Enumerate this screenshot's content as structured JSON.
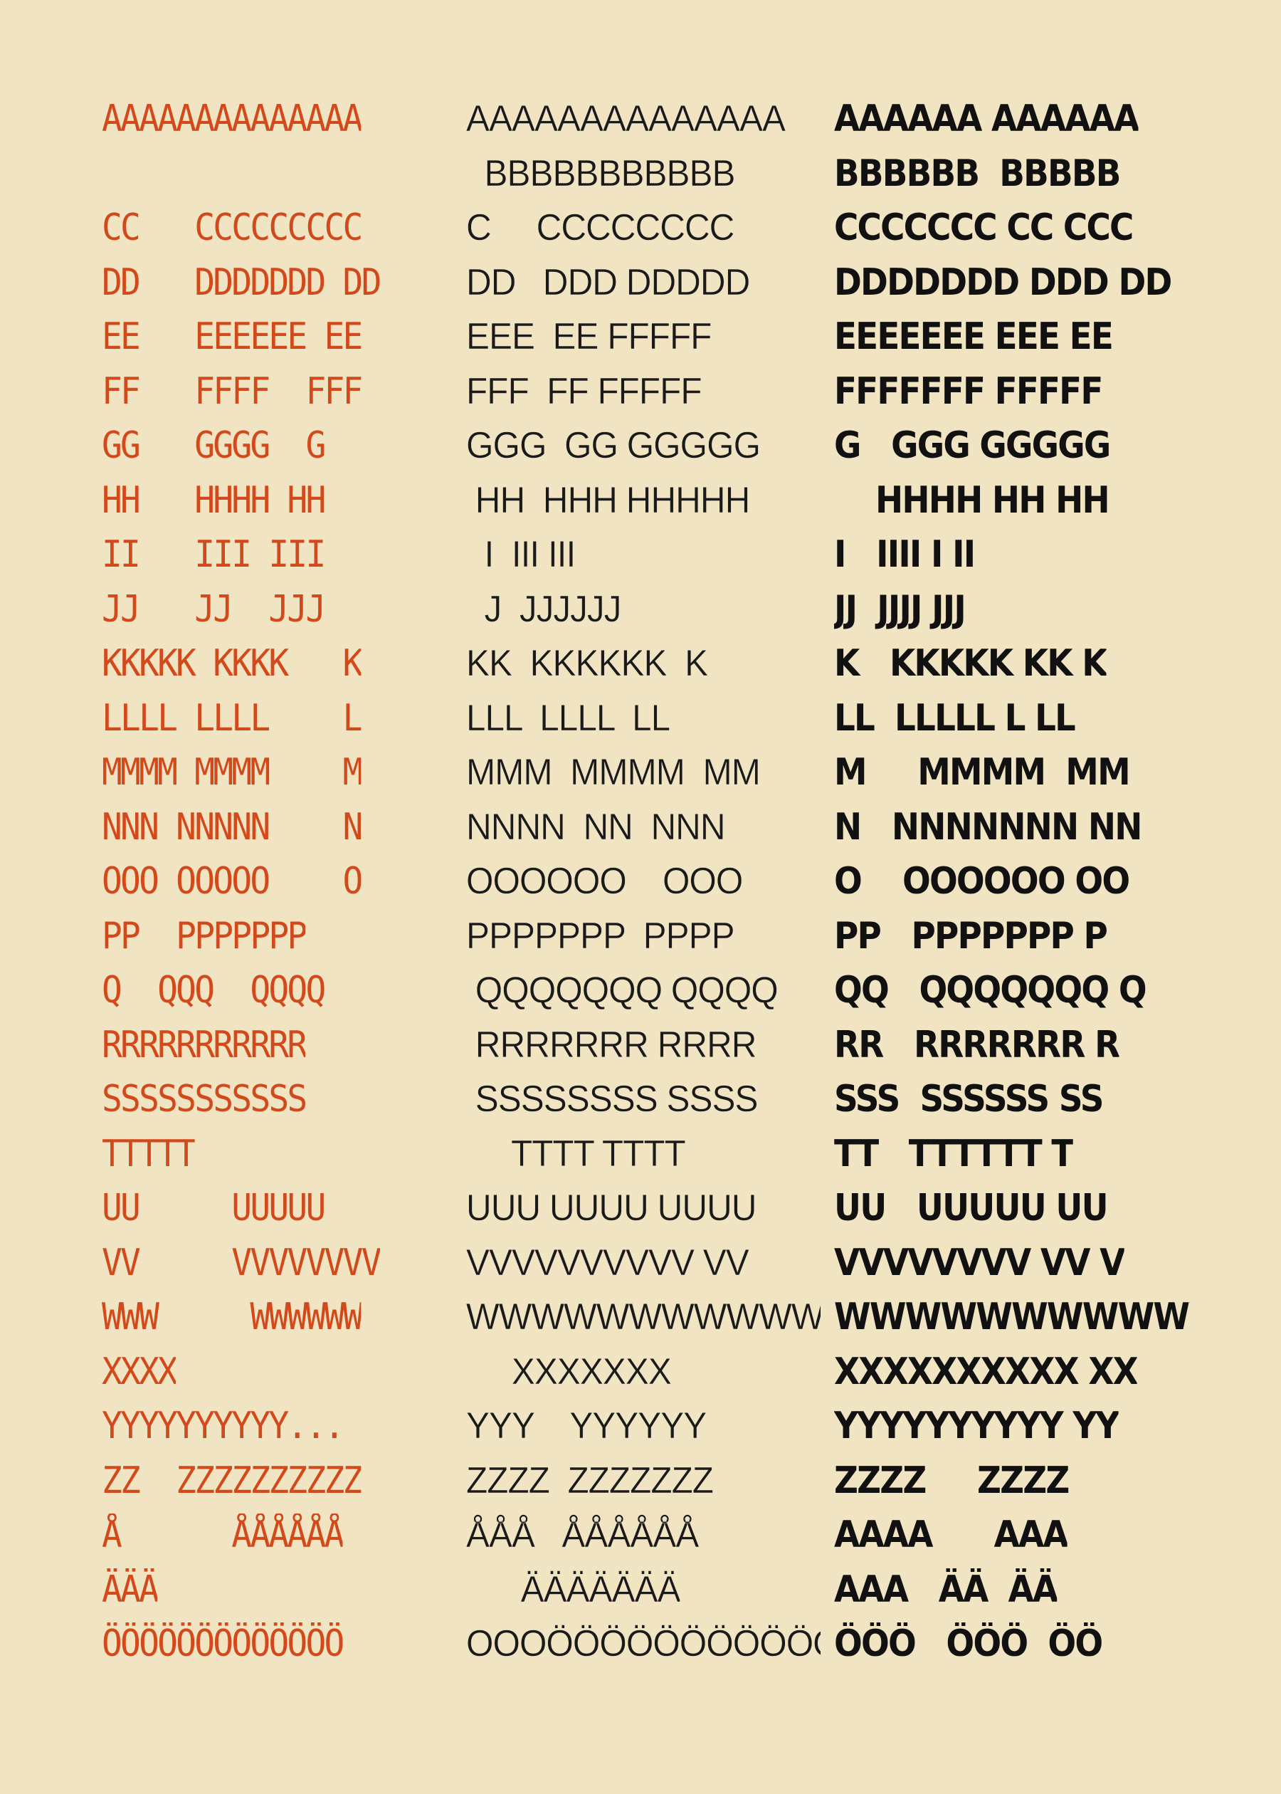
{
  "poster": {
    "background_color": "#f1e4c3",
    "columns": [
      {
        "name": "red",
        "color": "#d24a1c",
        "lines": [
          "AAAAAAAAAAAAAA",
          "",
          "CC   CCCCCCCCC",
          "DD   DDDDDDD DD",
          "EE   EEEEEE EE",
          "FF   FFFF  FFF",
          "GG   GGGG  G",
          "HH   HHHH HH",
          "II   III III",
          "JJ   JJ  JJJ",
          "KKKKK KKKK   K",
          "LLLL LLLL    L",
          "MMMM MMMM    M",
          "NNN NNNNN    N",
          "OOO OOOOO    O",
          "PP  PPPPPPP",
          "Q  QQQ  QQQQ",
          "RRRRRRRRRRR",
          "SSSSSSSSSSS",
          "TTTTT",
          "UU     UUUUU",
          "VV     VVVVVVVV",
          "WWW     WWWWWW",
          "XXXX",
          "YYYYYYYYYY...",
          "ZZ  ZZZZZZZZZZ",
          "Å      ÅÅÅÅÅÅ",
          "ÄÄÄ",
          "ÖÖÖÖÖÖÖÖÖÖÖÖÖ"
        ]
      },
      {
        "name": "thin",
        "color": "#1a1a1a",
        "lines": [
          "AAAAAAAAAAAAAA",
          "  BBBBBBBBBBB",
          "C     CCCCCCCC",
          "DD   DDD DDDDD",
          "EEE  EE FFFFF",
          "FFF  FF FFFFF",
          "GGG  GG GGGGG",
          " HH  HHH HHHHH",
          "  I  III III",
          "  J  JJJJJJ",
          "KK  KKKKKK  K",
          "LLL  LLLL  LL",
          "MMM  MMMM  MM",
          "NNNN  NN  NNN",
          "OOOOOO    OOO",
          "PPPPPPP  PPPP",
          " QQQQQQQ QQQQ",
          " RRRRRRR RRRR",
          " SSSSSSSS SSSS",
          "     TTTT TTTT",
          "UUU UUUU UUUU",
          "VVVVVVVVVV VV",
          "WWWWWWWWWWWWWW",
          "     XXXXXXX",
          "YYY    YYYYYY",
          "ZZZZ  ZZZZZZZ",
          "ÅÅÅ   ÅÅÅÅÅÅ",
          "      ÄÄÄÄÄÄÄ",
          "OOOÖÖÖÖÖÖÖÖÖÖÖ"
        ]
      },
      {
        "name": "bold",
        "color": "#111111",
        "lines": [
          "AAAAAA AAAAAA",
          "BBBBBB  BBBBB",
          "CCCCCCC CC CCC",
          "DDDDDDD DDD DD",
          "EEEEEEE EEE EE",
          "FFFFFFF FFFFF",
          "G   GGG GGGGG",
          "    HHHH HH HH",
          "I   IIII I II",
          "JJ  JJJJ JJJ",
          "K   KKKKK KK K",
          "LL  LLLLL L LL",
          "M     MMMM  MM",
          "N   NNNNNNN NN",
          "O    OOOOOO OO",
          "PP   PPPPPPP P",
          "QQ   QQQQQQQ Q",
          "RR   RRRRRRR R",
          "SSS  SSSSSS SS",
          "TT   TTTTTT T",
          "UU   UUUUU UU",
          "VVVVVVVV VV V",
          "WWWWWWWWWWWWWW",
          "XXXXXXXXXX XX",
          "YYYYYYYYYY YY",
          "ZZZZ     ZZZZ",
          "AAAA      AAA",
          "AAA   ÄÄ  ÄÄ",
          "ÖÖÖ   ÖÖÖ  ÖÖ"
        ]
      }
    ]
  }
}
